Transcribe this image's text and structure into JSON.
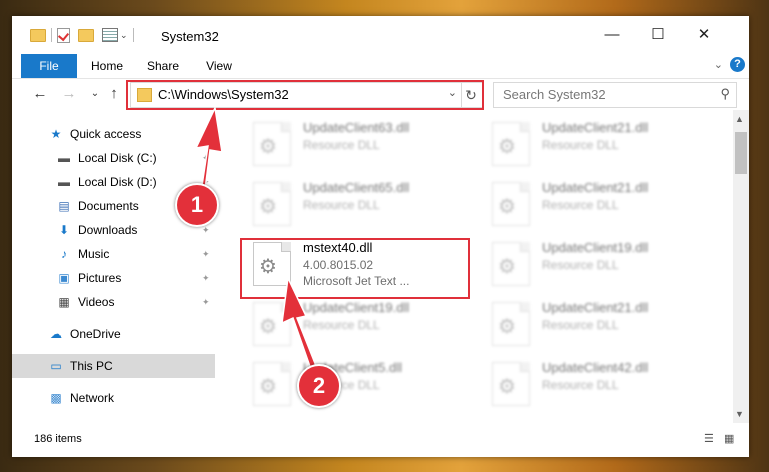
{
  "window": {
    "title": "System32",
    "minimize_glyph": "—",
    "maximize_glyph": "☐",
    "close_glyph": "✕"
  },
  "ribbon": {
    "tabs": [
      "File",
      "Home",
      "Share",
      "View"
    ],
    "expand_glyph": "⌄",
    "help_glyph": "?"
  },
  "nav": {
    "back_glyph": "←",
    "forward_glyph": "→",
    "recent_glyph": "⌄",
    "up_glyph": "↑",
    "address": "C:\\Windows\\System32",
    "address_dropdown_glyph": "⌄",
    "refresh_glyph": "↻",
    "search_placeholder": "Search System32",
    "search_glyph": "⚲"
  },
  "sidebar": {
    "items": [
      {
        "label": "Quick access",
        "icon": "star-icon",
        "glyph": "★",
        "color": "#1979ca",
        "pinned": false
      },
      {
        "label": "Local Disk (C:)",
        "icon": "drive-icon",
        "glyph": "▬",
        "color": "#555555",
        "pinned": true
      },
      {
        "label": "Local Disk (D:)",
        "icon": "drive-icon",
        "glyph": "▬",
        "color": "#555555",
        "pinned": true
      },
      {
        "label": "Documents",
        "icon": "documents-icon",
        "glyph": "▤",
        "color": "#3c6fb5",
        "pinned": true
      },
      {
        "label": "Downloads",
        "icon": "downloads-icon",
        "glyph": "⬇",
        "color": "#1979ca",
        "pinned": true
      },
      {
        "label": "Music",
        "icon": "music-icon",
        "glyph": "♪",
        "color": "#1979ca",
        "pinned": true
      },
      {
        "label": "Pictures",
        "icon": "pictures-icon",
        "glyph": "▣",
        "color": "#3c8ad1",
        "pinned": true
      },
      {
        "label": "Videos",
        "icon": "videos-icon",
        "glyph": "▦",
        "color": "#444444",
        "pinned": true
      },
      {
        "label": "OneDrive",
        "icon": "onedrive-icon",
        "glyph": "☁",
        "color": "#1979ca",
        "pinned": false
      },
      {
        "label": "This PC",
        "icon": "this-pc-icon",
        "glyph": "▭",
        "color": "#1979ca",
        "pinned": false
      },
      {
        "label": "Network",
        "icon": "network-icon",
        "glyph": "▩",
        "color": "#3c8ad1",
        "pinned": false
      }
    ],
    "pin_glyph": "📌"
  },
  "files": [
    {
      "name": "UpdateClient63.dll",
      "meta": "Resource DLL",
      "desc": "",
      "blurred": true
    },
    {
      "name": "UpdateClient21.dll",
      "meta": "Resource DLL",
      "desc": "",
      "blurred": true
    },
    {
      "name": "UpdateClient65.dll",
      "meta": "Resource DLL",
      "desc": "",
      "blurred": true
    },
    {
      "name": "UpdateClient21.dll",
      "meta": "Resource DLL",
      "desc": "",
      "blurred": true
    },
    {
      "name": "mstext40.dll",
      "meta": "4.00.8015.02",
      "desc": "Microsoft Jet Text ...",
      "blurred": false
    },
    {
      "name": "UpdateClient19.dll",
      "meta": "Resource DLL",
      "desc": "",
      "blurred": true
    },
    {
      "name": "UpdateClient19.dll",
      "meta": "Resource DLL",
      "desc": "",
      "blurred": true
    },
    {
      "name": "UpdateClient21.dll",
      "meta": "Resource DLL",
      "desc": "",
      "blurred": true
    },
    {
      "name": "UpdateClient5.dll",
      "meta": "Resource DLL",
      "desc": "",
      "blurred": true
    },
    {
      "name": "UpdateClient42.dll",
      "meta": "Resource DLL",
      "desc": "",
      "blurred": true
    }
  ],
  "status": {
    "item_count": "186 items"
  },
  "annotations": {
    "badge1": "1",
    "badge2": "2",
    "highlight_color": "#e0303a"
  }
}
